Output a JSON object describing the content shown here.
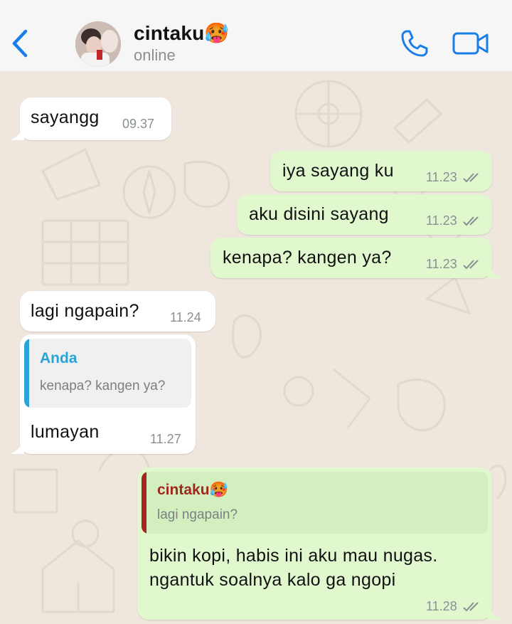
{
  "header": {
    "contact_name": "cintaku🥵",
    "status": "online"
  },
  "colors": {
    "ios_blue": "#1a7ee8",
    "incoming_bubble": "#ffffff",
    "outgoing_bubble": "#e1f8cf",
    "quote_blue": "#2aa3d8",
    "quote_red": "#a0281e",
    "chat_background": "#efe7de"
  },
  "icons": {
    "back": "chevron-left-icon",
    "call": "phone-icon",
    "video": "video-camera-icon",
    "read_receipt": "double-check-icon"
  },
  "messages": [
    {
      "direction": "in",
      "text": "sayangg",
      "time": "09.37"
    },
    {
      "direction": "out",
      "text": "iya sayang ku",
      "time": "11.23",
      "read": true
    },
    {
      "direction": "out",
      "text": "aku disini sayang",
      "time": "11.23",
      "read": true
    },
    {
      "direction": "out",
      "text": "kenapa? kangen ya?",
      "time": "11.23",
      "read": true
    },
    {
      "direction": "in",
      "text": "lagi ngapain?",
      "time": "11.24"
    },
    {
      "direction": "in",
      "reply_to": {
        "name": "Anda",
        "text": "kenapa? kangen ya?"
      },
      "text": "lumayan",
      "time": "11.27"
    },
    {
      "direction": "out",
      "reply_to": {
        "name": "cintaku🥵",
        "text": "lagi ngapain?"
      },
      "text_lines": [
        "bikin kopi, habis ini aku mau nugas.",
        "ngantuk soalnya kalo ga ngopi"
      ],
      "time": "11.28",
      "read": true
    }
  ]
}
